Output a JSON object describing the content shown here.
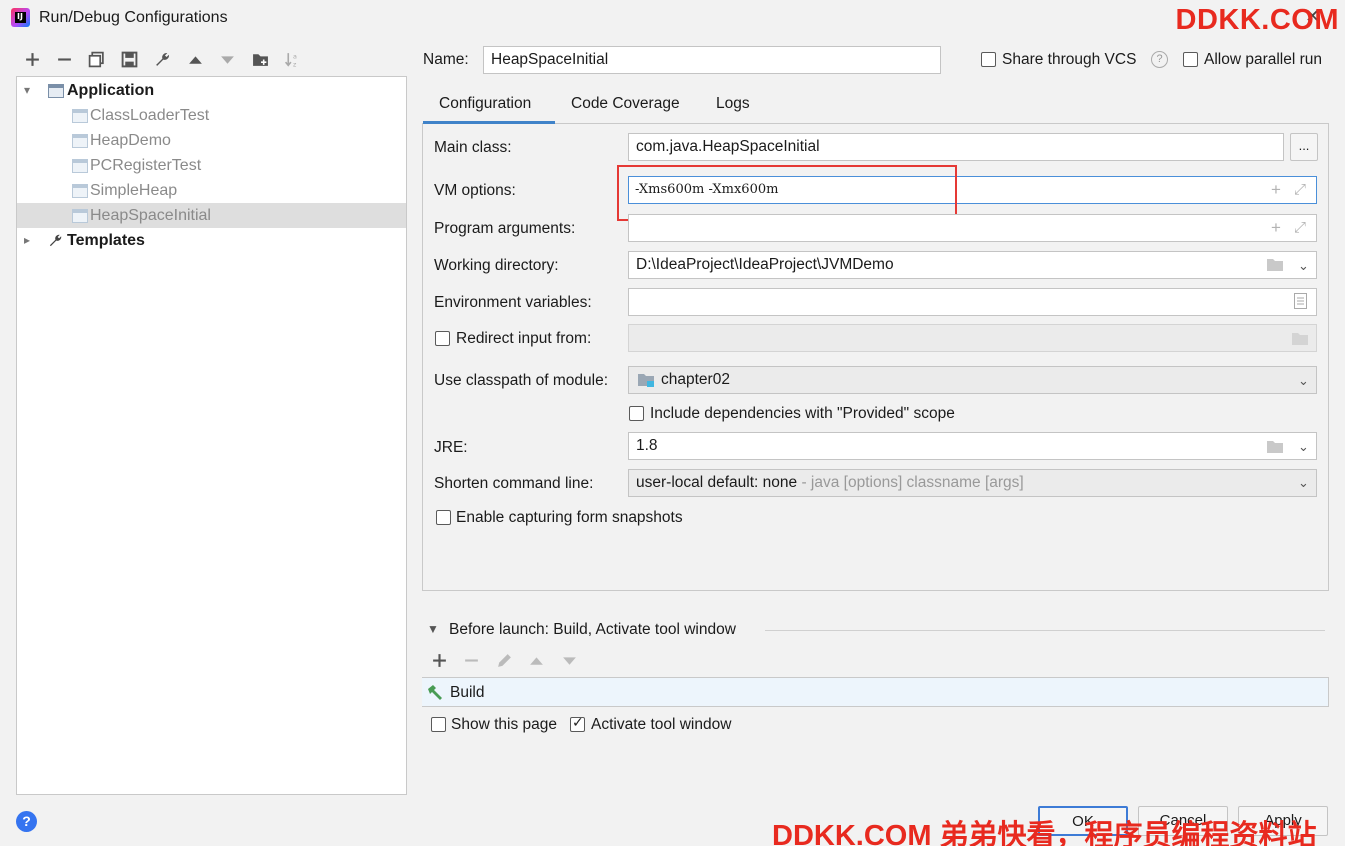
{
  "window": {
    "title": "Run/Debug Configurations"
  },
  "watermark": {
    "top": "DDKK.COM",
    "bottom": "DDKK.COM 弟弟快看，程序员编程资料站"
  },
  "tree": {
    "application_label": "Application",
    "children": [
      "ClassLoaderTest",
      "HeapDemo",
      "PCRegisterTest",
      "SimpleHeap",
      "HeapSpaceInitial"
    ],
    "selected": "HeapSpaceInitial",
    "templates_label": "Templates"
  },
  "header": {
    "name_label": "Name:",
    "name_value": "HeapSpaceInitial",
    "share_vcs_label": "Share through VCS",
    "allow_parallel_label": "Allow parallel run"
  },
  "tabs": [
    "Configuration",
    "Code Coverage",
    "Logs"
  ],
  "form": {
    "main_class_label": "Main class:",
    "main_class_value": "com.java.HeapSpaceInitial",
    "browse_label": "...",
    "vm_options_label": "VM options:",
    "vm_options_value": "-Xms600m -Xmx600m",
    "program_args_label": "Program arguments:",
    "program_args_value": "",
    "working_dir_label": "Working directory:",
    "working_dir_value": "D:\\IdeaProject\\IdeaProject\\JVMDemo",
    "env_vars_label": "Environment variables:",
    "env_vars_value": "",
    "redirect_label": "Redirect input from:",
    "classpath_label": "Use classpath of module:",
    "classpath_value": "chapter02",
    "include_deps_label": "Include dependencies with \"Provided\" scope",
    "jre_label": "JRE:",
    "jre_value": "1.8",
    "shorten_label": "Shorten command line:",
    "shorten_value": "user-local default: none",
    "shorten_hint": " - java [options] classname [args]",
    "capture_label": "Enable capturing form snapshots"
  },
  "before_launch": {
    "title": "Before launch: Build, Activate tool window",
    "item": "Build",
    "show_page_label": "Show this page",
    "activate_label": "Activate tool window"
  },
  "buttons": {
    "ok": "OK",
    "cancel": "Cancel",
    "apply": "Apply"
  },
  "colors": {
    "accent": "#4083c9",
    "highlight_box": "#e53935",
    "watermark": "#e82a1f"
  }
}
